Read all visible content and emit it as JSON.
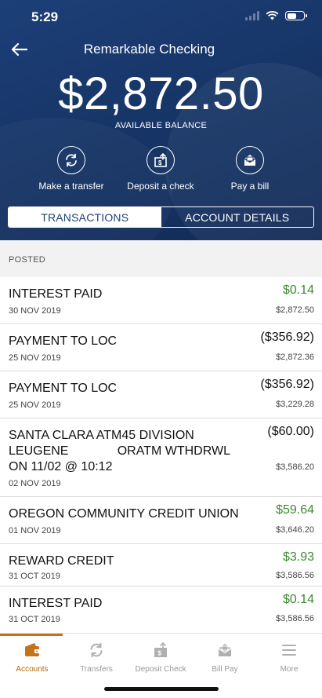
{
  "status_bar": {
    "time": "5:29"
  },
  "header": {
    "title": "Remarkable Checking",
    "balance": "$2,872.50",
    "balance_label": "AVAILABLE BALANCE"
  },
  "actions": [
    {
      "label": "Make a transfer",
      "icon": "transfer-icon"
    },
    {
      "label": "Deposit a check",
      "icon": "deposit-check-icon"
    },
    {
      "label": "Pay a bill",
      "icon": "pay-bill-icon"
    }
  ],
  "tabs": [
    {
      "label": "TRANSACTIONS",
      "active": true
    },
    {
      "label": "ACCOUNT DETAILS",
      "active": false
    }
  ],
  "section": {
    "label": "POSTED"
  },
  "transactions": [
    {
      "description": "INTEREST PAID",
      "date": "30 NOV 2019",
      "amount": "$0.14",
      "balance": "$2,872.50",
      "type": "credit"
    },
    {
      "description": "PAYMENT TO LOC",
      "date": "25 NOV 2019",
      "amount": "($356.92)",
      "balance": "$2,872.36",
      "type": "debit"
    },
    {
      "description": "PAYMENT TO LOC",
      "date": "25 NOV 2019",
      "amount": "($356.92)",
      "balance": "$3,229.28",
      "type": "debit"
    },
    {
      "description": "SANTA CLARA ATM45 DIVISION\nLEUGENE              ORATM WTHDRWL\nON 11/02 @ 10:12",
      "date": "02 NOV 2019",
      "amount": "($60.00)",
      "balance": "$3,586.20",
      "type": "debit"
    },
    {
      "description": "OREGON COMMUNITY CREDIT UNION",
      "date": "01 NOV 2019",
      "amount": "$59.64",
      "balance": "$3,646.20",
      "type": "credit"
    },
    {
      "description": "REWARD CREDIT",
      "date": "31 OCT 2019",
      "amount": "$3.93",
      "balance": "$3,586.56",
      "type": "credit"
    },
    {
      "description": "INTEREST PAID",
      "date": "31 OCT 2019",
      "amount": "$0.14",
      "balance": "$3,586.56",
      "type": "credit"
    }
  ],
  "bottom_nav": [
    {
      "label": "Accounts",
      "icon": "wallet-icon",
      "active": true
    },
    {
      "label": "Transfers",
      "icon": "transfers-icon",
      "active": false
    },
    {
      "label": "Deposit Check",
      "icon": "deposit-check-icon",
      "active": false
    },
    {
      "label": "Bill Pay",
      "icon": "bill-pay-icon",
      "active": false
    },
    {
      "label": "More",
      "icon": "menu-icon",
      "active": false
    }
  ],
  "colors": {
    "header_bg": "#173668",
    "credit": "#3c8a2e",
    "nav_active": "#c4731b"
  }
}
